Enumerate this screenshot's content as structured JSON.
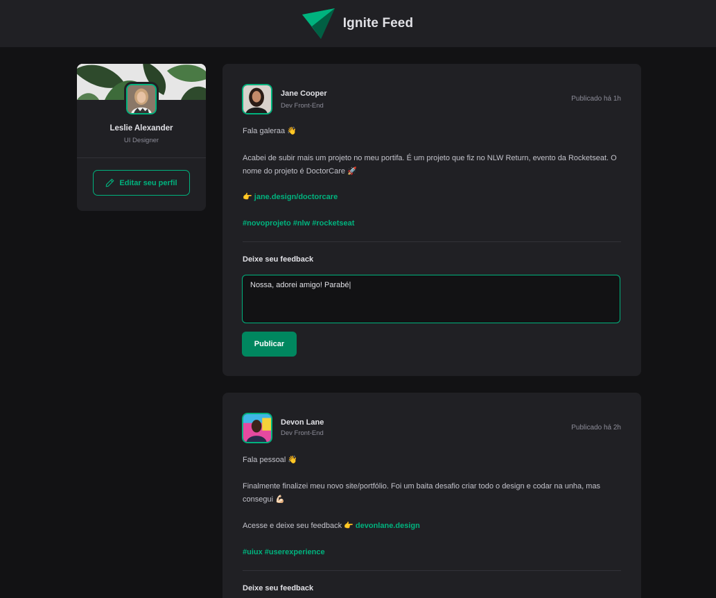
{
  "header": {
    "title": "Ignite Feed",
    "logo_icon": "ignite-logo-icon"
  },
  "colors": {
    "accent": "#00b37e",
    "button": "#00875f",
    "background": "#121214",
    "surface": "#202024"
  },
  "profile": {
    "name": "Leslie Alexander",
    "role": "UI Designer",
    "edit_label": "Editar seu perfil",
    "edit_icon": "pencil-icon"
  },
  "posts": [
    {
      "author": "Jane Cooper",
      "role": "Dev Front-End",
      "published": "Publicado há 1h",
      "greeting": "Fala galeraa 👋",
      "body": "Acabei de subir mais um projeto no meu portifa. É um projeto que fiz no NLW Return, evento da Rocketseat. O nome do projeto é DoctorCare 🚀",
      "link_prefix": "👉 ",
      "link": "jane.design/doctorcare",
      "hashtags": "#novoprojeto #nlw #rocketseat",
      "feedback_title": "Deixe seu feedback",
      "comment_value": "Nossa, adorei amigo! Parabé|",
      "publish_label": "Publicar"
    },
    {
      "author": "Devon Lane",
      "role": "Dev Front-End",
      "published": "Publicado há 2h",
      "greeting": "Fala pessoal 👋",
      "body": "Finalmente finalizei meu novo site/portfólio. Foi um baita desafio criar todo o design e codar na unha, mas consegui 💪🏻",
      "link_prefix": "Acesse e deixe seu feedback 👉 ",
      "link": "devonlane.design",
      "hashtags": "#uiux #userexperience",
      "feedback_title": "Deixe seu feedback"
    }
  ]
}
